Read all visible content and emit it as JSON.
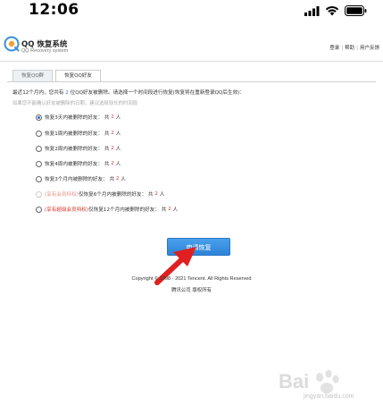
{
  "status_bar": {
    "time": "12:06"
  },
  "header": {
    "title": "QQ 恢复系统",
    "subtitle": "QQ Recovery system",
    "links": [
      "登录",
      "帮助",
      "用户反馈"
    ]
  },
  "tabs": [
    {
      "label": "恢复QQ群",
      "active": false
    },
    {
      "label": "恢复QQ好友",
      "active": true
    }
  ],
  "intro": {
    "prefix": "最近12个月内，您共有",
    "count": "2",
    "suffix": "位QQ好友被删除。请选择一个时间段进行恢复(恢复将在重新登录QQ后生效)：",
    "hint": "如果您不能确认好友被删除的日期，建议选择较长的时间段"
  },
  "options": [
    {
      "tag": "",
      "label": "恢复3天内被删除的好友：",
      "total_prefix": "共",
      "count": "2",
      "unit": "人",
      "checked": true,
      "disabled": false
    },
    {
      "tag": "",
      "label": "恢复1周内被删除的好友：",
      "total_prefix": "共",
      "count": "2",
      "unit": "人",
      "checked": false,
      "disabled": false
    },
    {
      "tag": "",
      "label": "恢复2周内被删除的好友：",
      "total_prefix": "共",
      "count": "2",
      "unit": "人",
      "checked": false,
      "disabled": false
    },
    {
      "tag": "",
      "label": "恢复4周内被删除的好友：",
      "total_prefix": "共",
      "count": "2",
      "unit": "人",
      "checked": false,
      "disabled": false
    },
    {
      "tag": "",
      "label": "恢复3个月内被删除的好友：",
      "total_prefix": "共",
      "count": "2",
      "unit": "人",
      "checked": false,
      "disabled": false
    },
    {
      "tag": "(享有会员特权)",
      "label": "仅恢复6个月内被删除的好友：",
      "total_prefix": "共",
      "count": "2",
      "unit": "人",
      "checked": false,
      "disabled": true
    },
    {
      "tag": "(享有超级会员特权)",
      "label": "仅恢复12个月内被删除的好友：",
      "total_prefix": "共",
      "count": "2",
      "unit": "人",
      "checked": false,
      "disabled": false
    }
  ],
  "apply_button": "申请恢复",
  "footer": {
    "copyright": "Copyright © 1998 - 2021 Tencent. All Rights Reserved",
    "company": "腾讯公司 版权所有"
  },
  "watermark": {
    "text": "Bai",
    "sub": "jingyan.baidu.com"
  },
  "colors": {
    "accent_blue": "#2d83d6",
    "count_red": "#d9342b",
    "arrow_red": "#e02020"
  }
}
